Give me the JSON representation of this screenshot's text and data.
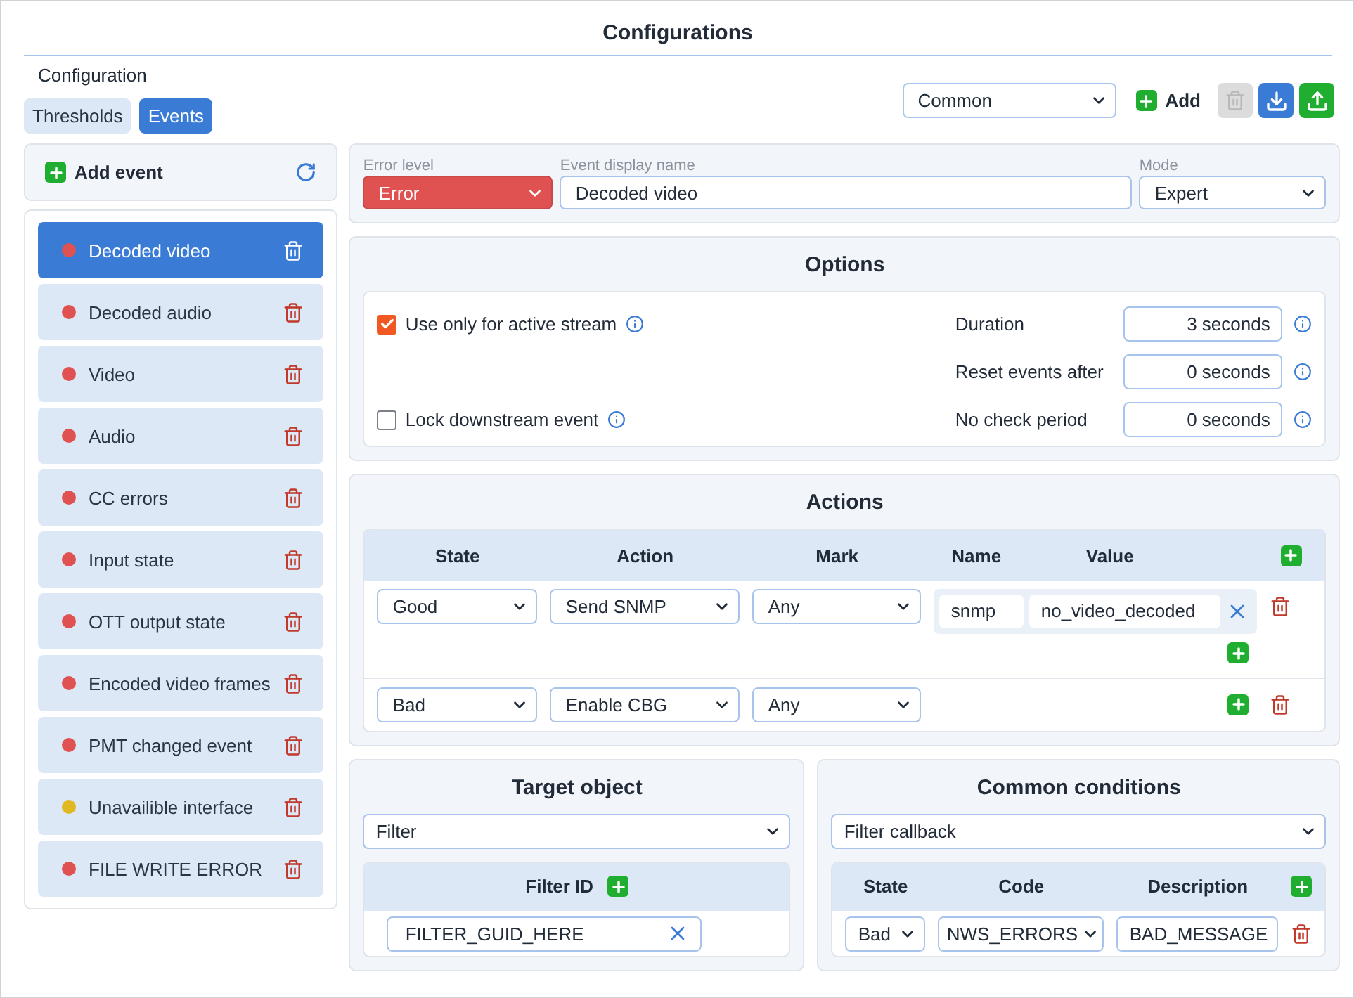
{
  "title": "Configurations",
  "configuration_label": "Configuration",
  "tabs": [
    {
      "label": "Thresholds",
      "selected": false
    },
    {
      "label": "Events",
      "selected": true
    }
  ],
  "toolbar": {
    "preset": "Common",
    "add_label": "Add",
    "delete_disabled": true
  },
  "add_event_label": "Add event",
  "events": [
    {
      "name": "Decoded video",
      "color": "#e05252",
      "selected": true
    },
    {
      "name": "Decoded audio",
      "color": "#e05252",
      "selected": false
    },
    {
      "name": "Video",
      "color": "#e05252",
      "selected": false
    },
    {
      "name": "Audio",
      "color": "#e05252",
      "selected": false
    },
    {
      "name": "CC errors",
      "color": "#e05252",
      "selected": false
    },
    {
      "name": "Input state",
      "color": "#e05252",
      "selected": false
    },
    {
      "name": "OTT output state",
      "color": "#e05252",
      "selected": false
    },
    {
      "name": "Encoded video frames",
      "color": "#e05252",
      "selected": false
    },
    {
      "name": "PMT changed event",
      "color": "#e05252",
      "selected": false
    },
    {
      "name": "Unavailible interface",
      "color": "#e0b820",
      "selected": false
    },
    {
      "name": "FILE WRITE ERROR",
      "color": "#e05252",
      "selected": false
    }
  ],
  "event_header": {
    "error_level_label": "Error level",
    "error_level": "Error",
    "display_name_label": "Event display name",
    "display_name": "Decoded video",
    "mode_label": "Mode",
    "mode": "Expert"
  },
  "options": {
    "title": "Options",
    "checks": [
      {
        "label": "Use only for active stream",
        "checked": true
      },
      {
        "label": "Lock downstream event",
        "checked": false
      }
    ],
    "fields": [
      {
        "label": "Duration",
        "value": "3 seconds"
      },
      {
        "label": "Reset events after",
        "value": "0 seconds"
      },
      {
        "label": "No check period",
        "value": "0 seconds"
      }
    ]
  },
  "actions": {
    "title": "Actions",
    "columns": [
      "State",
      "Action",
      "Mark",
      "Name",
      "Value"
    ],
    "rows": [
      {
        "state": "Good",
        "action": "Send SNMP",
        "mark": "Any",
        "params": [
          {
            "name": "snmp",
            "value": "no_video_decoded"
          }
        ]
      },
      {
        "state": "Bad",
        "action": "Enable CBG",
        "mark": "Any"
      }
    ]
  },
  "target": {
    "title": "Target object",
    "type": "Filter",
    "column": "Filter ID",
    "ids": [
      "FILTER_GUID_HERE"
    ]
  },
  "conditions": {
    "title": "Common conditions",
    "type": "Filter callback",
    "columns": [
      "State",
      "Code",
      "Description"
    ],
    "rows": [
      {
        "state": "Bad",
        "code": "NWS_ERRORS",
        "description": "BAD_MESSAGE"
      }
    ]
  }
}
